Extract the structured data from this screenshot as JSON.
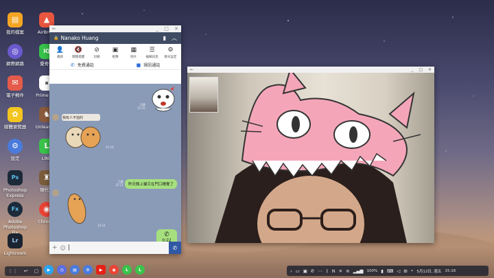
{
  "desktop_icons": [
    {
      "label": "我的檔案",
      "icon": "folder-icon",
      "color": "#f4a623",
      "glyph": "▤"
    },
    {
      "label": "AirBru…",
      "icon": "airbrush-icon",
      "color": "#e8563f",
      "glyph": "▲"
    },
    {
      "label": "網際網路",
      "icon": "internet-icon",
      "color": "#6a5acd",
      "glyph": "◎"
    },
    {
      "label": "愛奇…",
      "icon": "iqiyi-icon",
      "color": "#37c24a",
      "glyph": "iQ"
    },
    {
      "label": "電子郵件",
      "icon": "email-icon",
      "color": "#e45b4b",
      "glyph": "✉"
    },
    {
      "label": "Prime V…",
      "icon": "prime-video-icon",
      "color": "#ffffff",
      "glyph": "a"
    },
    {
      "label": "媒體瀏覽器",
      "icon": "media-browser-icon",
      "color": "#f3c520",
      "glyph": "✿"
    },
    {
      "label": "Unleash…",
      "icon": "unleash-icon",
      "color": "#8b5a3c",
      "glyph": "♞"
    },
    {
      "label": "設定",
      "icon": "settings-icon",
      "color": "#4a7bdc",
      "glyph": "⚙"
    },
    {
      "label": "LINE",
      "icon": "line-icon",
      "color": "#3ac34a",
      "glyph": "L"
    },
    {
      "label": "Photoshop Express",
      "icon": "photoshop-express-icon",
      "color": "#1c2a3a",
      "glyph": "Ps"
    },
    {
      "label": "現代…",
      "icon": "game-icon",
      "color": "#7b5c3a",
      "glyph": "♜"
    },
    {
      "label": "Adobe Photoshop Fix",
      "icon": "photoshop-fix-icon",
      "color": "#1c2a3a",
      "glyph": "Fx"
    },
    {
      "label": "Chrome",
      "icon": "chrome-icon",
      "color": "#ea4335",
      "glyph": "◉"
    },
    {
      "label": "Lightroom",
      "icon": "lightroom-icon",
      "color": "#1b2430",
      "glyph": "Lr"
    }
  ],
  "chat": {
    "contact_name": "Nanako Huang",
    "menu": [
      {
        "label": "邀請",
        "icon": "invite-icon",
        "glyph": "👤"
      },
      {
        "label": "關閉提醒",
        "icon": "mute-icon",
        "glyph": "🔇"
      },
      {
        "label": "封鎖",
        "icon": "block-icon",
        "glyph": "⊘"
      },
      {
        "label": "相簿",
        "icon": "album-icon",
        "glyph": "▣"
      },
      {
        "label": "照片",
        "icon": "photos-icon",
        "glyph": "▦"
      },
      {
        "label": "編輯訊息",
        "icon": "edit-messages-icon",
        "glyph": "☰"
      },
      {
        "label": "聊天設定",
        "icon": "chat-settings-icon",
        "glyph": "⚙"
      }
    ],
    "free_call": "免費通話",
    "video_call": "視訊通話",
    "messages": {
      "sticker_top_read": "已讀",
      "sticker_top_time": "15:10",
      "sticker_sender_time": "15:10",
      "green_read": "已讀",
      "green_time": "15:11",
      "green_text": "昨天晚上貓又在門口睡覺了",
      "sticker2_time": "15:12",
      "call_duration": "0:22",
      "call_time": "15:13"
    },
    "sticker_caption": "我有人不拍的"
  },
  "taskbar": {
    "battery": "100%",
    "date_time": "5月12日, 週五",
    "clock": "15:16"
  }
}
